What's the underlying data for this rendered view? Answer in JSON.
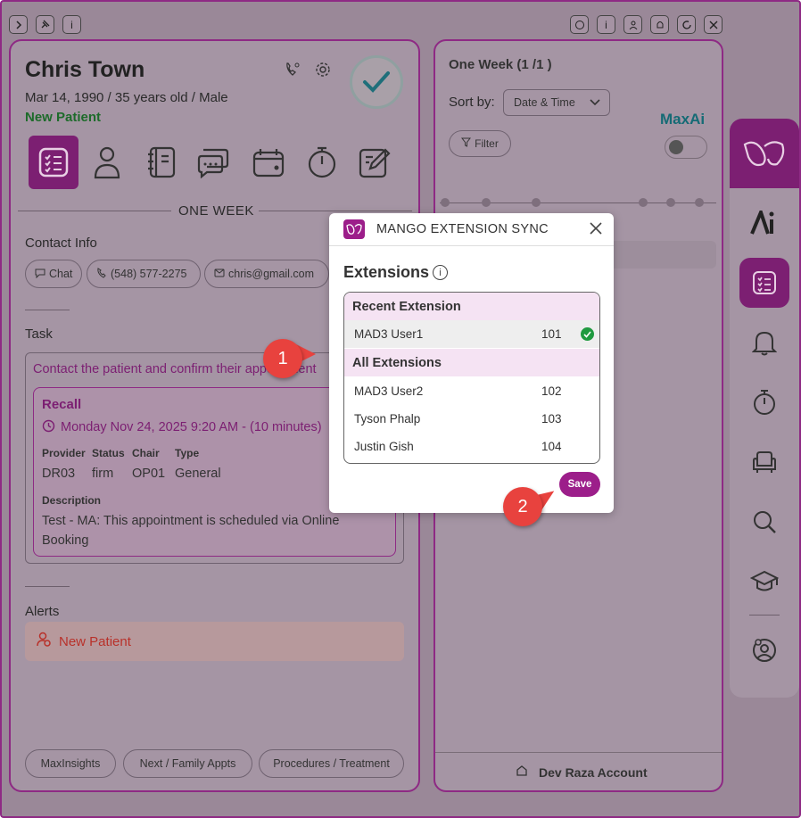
{
  "toolbar_left": [
    {
      "icon": "chevron-right-icon",
      "glyph": "›"
    },
    {
      "icon": "pin-icon",
      "glyph": "⚲"
    },
    {
      "icon": "info-icon",
      "glyph": "i"
    }
  ],
  "toolbar_right": [
    {
      "icon": "mango-icon",
      "glyph": "◎"
    },
    {
      "icon": "info-icon",
      "glyph": "i"
    },
    {
      "icon": "user-icon",
      "glyph": "⚇"
    },
    {
      "icon": "bell-icon",
      "glyph": "△"
    },
    {
      "icon": "refresh-icon",
      "glyph": "↻"
    },
    {
      "icon": "close-icon",
      "glyph": "✕"
    }
  ],
  "patient": {
    "name": "Chris Town",
    "details": "Mar 14, 1990 / 35 years old / Male",
    "status": "New Patient"
  },
  "section_title": "ONE WEEK",
  "contact": {
    "label": "Contact Info",
    "chat": "Chat",
    "phone": "(548) 577-2275",
    "email": "chris@gmail.com"
  },
  "task": {
    "label": "Task",
    "text": "Contact the patient and confirm their appointment",
    "recall": {
      "title": "Recall",
      "datetime": "Monday Nov 24, 2025 9:20 AM - (10 minutes)",
      "headers": [
        "Provider",
        "Status",
        "Chair",
        "Type"
      ],
      "values": [
        "DR03",
        "firm",
        "OP01",
        "General"
      ],
      "desc_label": "Description",
      "desc": "Test - MA: This appointment is scheduled via Online Booking"
    }
  },
  "alerts": {
    "label": "Alerts",
    "item": "New Patient"
  },
  "bottom_buttons": [
    "MaxInsights",
    "Next / Family Appts",
    "Procedures / Treatment"
  ],
  "right_panel": {
    "title": "One Week (1 /1 )",
    "sort_label": "Sort by:",
    "sort_value": "Date & Time",
    "maxai": "MaxAi",
    "filter": "Filter",
    "footer": "Dev Raza Account"
  },
  "modal": {
    "title": "MANGO EXTENSION SYNC",
    "heading": "Extensions",
    "recent_group": "Recent Extension",
    "all_group": "All Extensions",
    "recent": [
      {
        "name": "MAD3 User1",
        "ext": "101"
      }
    ],
    "all": [
      {
        "name": "MAD3 User2",
        "ext": "102"
      },
      {
        "name": "Tyson Phalp",
        "ext": "103"
      },
      {
        "name": "Justin Gish",
        "ext": "104"
      }
    ],
    "save": "Save"
  },
  "callouts": [
    "1",
    "2"
  ],
  "colors": {
    "brand": "#9c1e8a",
    "success": "#1f9a3f",
    "alert": "#b8312a",
    "callout": "#e8423e"
  }
}
